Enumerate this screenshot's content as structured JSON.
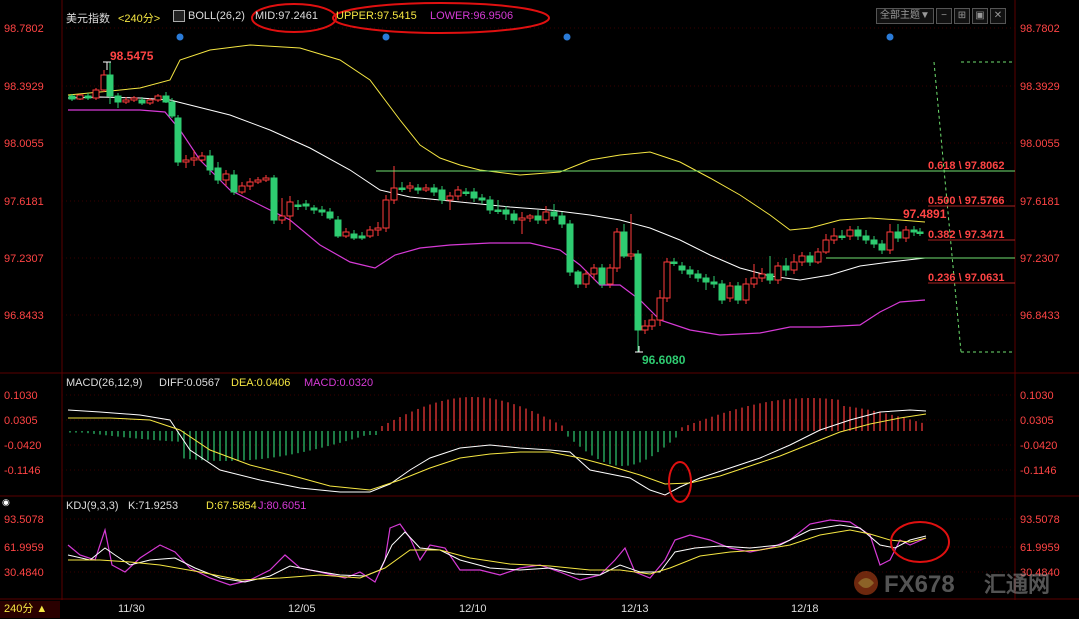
{
  "header": {
    "symbol": "美元指数",
    "period": "<240分>",
    "boll_label": "BOLL(26,2)",
    "mid": "MID:97.2461",
    "upper": "UPPER:97.5415",
    "lower": "LOWER:96.9506",
    "theme_button": "全部主题",
    "theme_arrow": "▼"
  },
  "macd_header": {
    "label": "MACD(26,12,9)",
    "diff": "DIFF:0.0567",
    "dea": "DEA:0.0406",
    "macd": "MACD:0.0320"
  },
  "kdj_header": {
    "label": "KDJ(9,3,3)",
    "k": "K:71.9253",
    "d": "D:67.5854",
    "j": "J:80.6051"
  },
  "price_axis": [
    "98.7802",
    "98.3929",
    "98.0055",
    "97.6181",
    "97.2307",
    "96.8433"
  ],
  "macd_axis": [
    "0.1030",
    "0.0305",
    "-0.0420",
    "-0.1146"
  ],
  "kdj_axis": [
    "93.5078",
    "61.9959",
    "30.4840"
  ],
  "x_axis": [
    "11/30",
    "12/05",
    "12/10",
    "12/13",
    "12/18"
  ],
  "annotations": {
    "high": "98.5475",
    "low": "96.6080",
    "recent_high": "97.4891"
  },
  "fib_levels": [
    "0.618 \\ 97.8062",
    "0.500 \\ 97.5766",
    "0.382 \\ 97.3471",
    "0.236 \\ 97.0631"
  ],
  "period_button": "240分 ▲",
  "watermark": "FX678",
  "watermark_cn": "汇通网",
  "colors": {
    "up": "#ff3b3b",
    "down": "#2ecc71",
    "axis_text": "#ff4444",
    "mid": "#ffffff",
    "upper": "#f5e642",
    "lower": "#d63ad6",
    "fib": "#6fe06f",
    "annotation_circle": "#e01010"
  }
}
